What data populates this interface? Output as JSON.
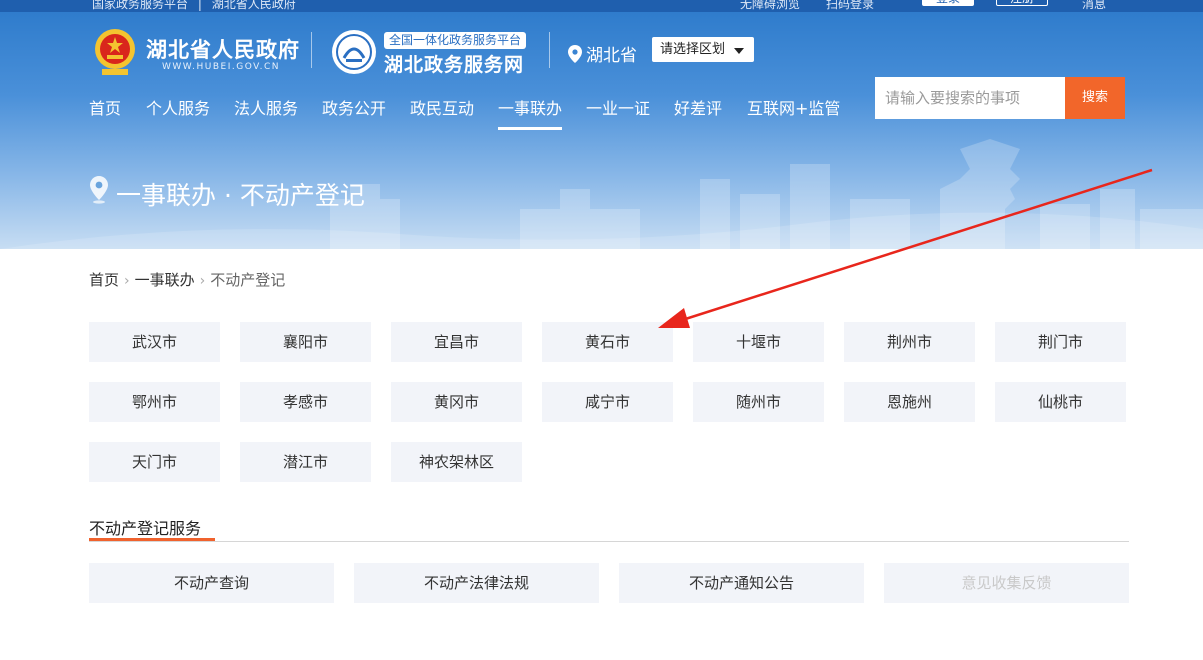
{
  "topbar": {
    "left_items": [
      "国家政务服务平台",
      "湖北省人民政府"
    ],
    "accessibility": "无障碍浏览",
    "scan_login": "扫码登录",
    "login": "登录",
    "register": "注册",
    "messages": "消息"
  },
  "header": {
    "gov_name": "湖北省人民政府",
    "gov_url": "WWW.HUBEI.GOV.CN",
    "platform_tag": "全国一体化政务服务平台",
    "platform_name": "湖北政务服务网",
    "location": "湖北省",
    "region_select": "请选择区划"
  },
  "nav": {
    "items": [
      "首页",
      "个人服务",
      "法人服务",
      "政务公开",
      "政民互动",
      "一事联办",
      "一业一证",
      "好差评",
      "互联网+监管"
    ],
    "active": "一事联办"
  },
  "search": {
    "placeholder": "请输入要搜索的事项",
    "button": "搜索"
  },
  "page": {
    "heading": "一事联办 · 不动产登记"
  },
  "breadcrumb": [
    "首页",
    "一事联办",
    "不动产登记"
  ],
  "cities": [
    [
      "武汉市",
      "襄阳市",
      "宜昌市",
      "黄石市",
      "十堰市",
      "荆州市",
      "荆门市"
    ],
    [
      "鄂州市",
      "孝感市",
      "黄冈市",
      "咸宁市",
      "随州市",
      "恩施州",
      "仙桃市"
    ],
    [
      "天门市",
      "潜江市",
      "神农架林区"
    ]
  ],
  "services": {
    "title": "不动产登记服务",
    "items": [
      "不动产查询",
      "不动产法律法规",
      "不动产通知公告",
      "意见收集反馈"
    ],
    "disabled_index": 3
  },
  "colors": {
    "primary": "#2f7ccc",
    "accent": "#f2662a",
    "tile": "#f2f4f9",
    "annotation": "#e8261c"
  }
}
